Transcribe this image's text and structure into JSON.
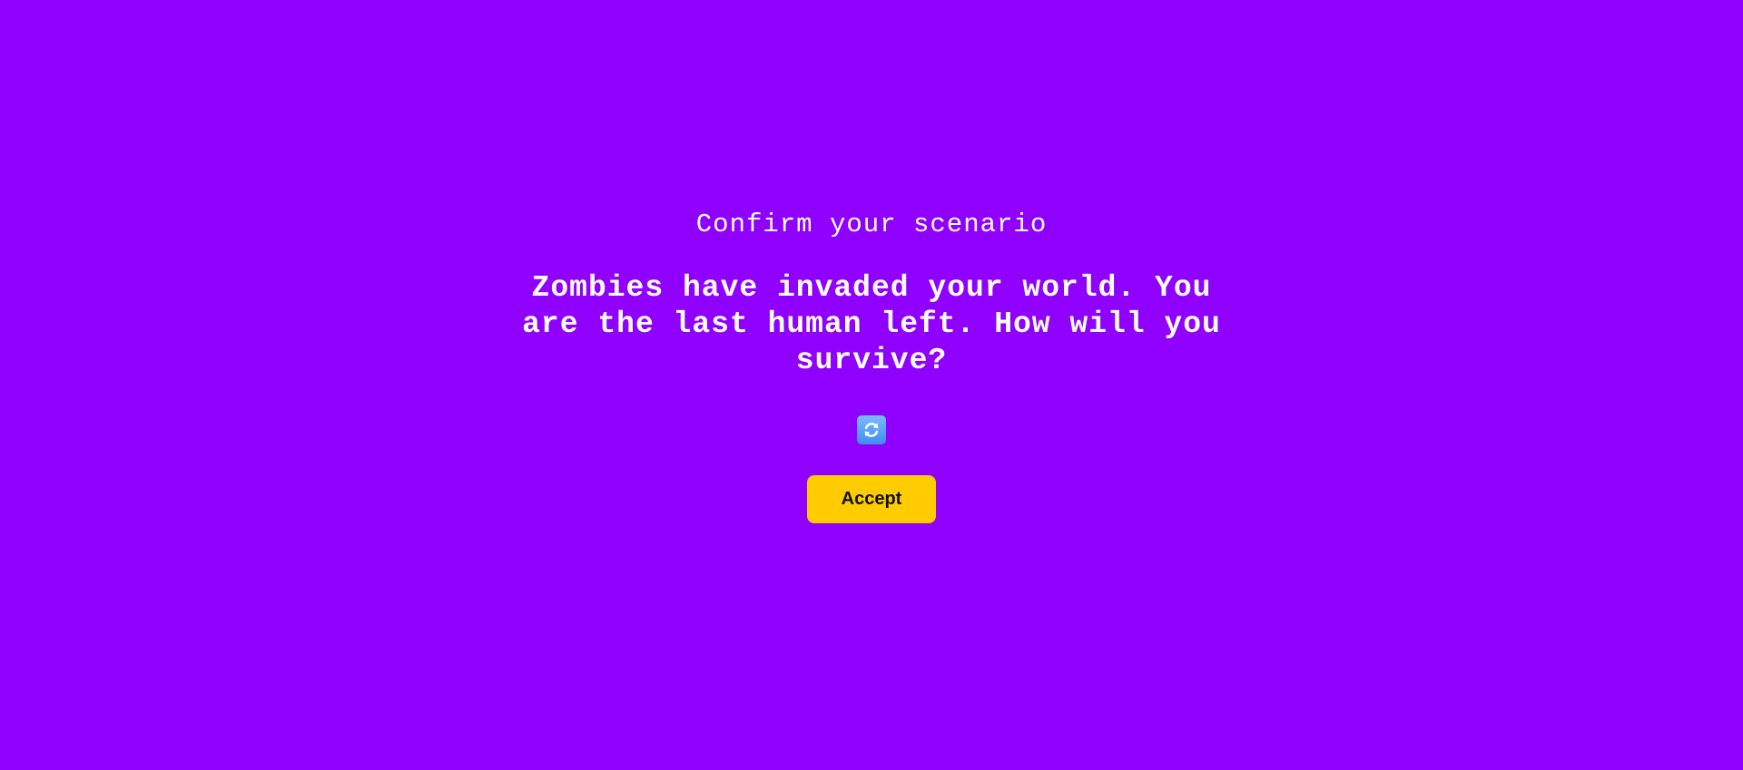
{
  "page": {
    "background_color": "#8f00ff"
  },
  "confirm": {
    "heading": "Confirm your scenario",
    "scenario_text": "Zombies have invaded your world. You are the last human left. How will you survive?",
    "refresh_icon": "refresh-icon",
    "accept_label": "Accept",
    "accept_color": "#ffcc00"
  }
}
